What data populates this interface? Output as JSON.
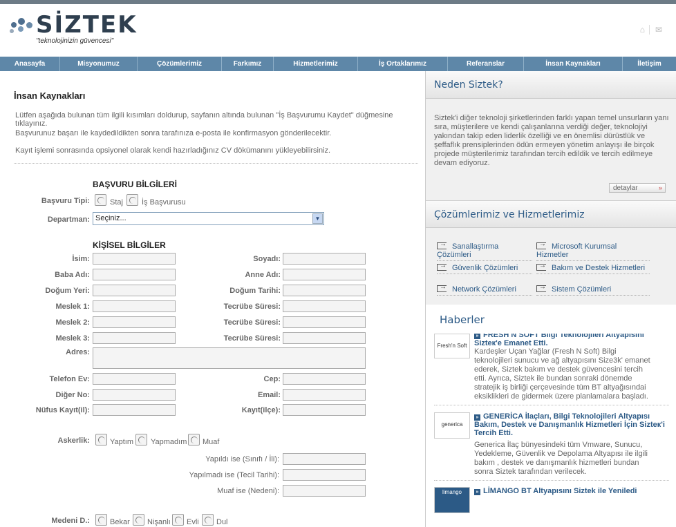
{
  "brand": {
    "logo_name": "SİZTEK",
    "tagline": "\"teknolojinizin güvencesi\""
  },
  "nav": [
    "Anasayfa",
    "Misyonumuz",
    "Çözümlerimiz",
    "Farkımız",
    "Hizmetlerimiz",
    "İş Ortaklarımız",
    "Referanslar",
    "İnsan Kaynakları",
    "İletişim"
  ],
  "page": {
    "title": "İnsan Kaynakları",
    "intro": [
      "Lütfen aşağıda bulunan tüm ilgili kısımları doldurup, sayfanın altında bulunan \"İş Başvurumu Kaydet\" düğmesine tıklayınız.",
      "Başvurunuz başarı ile kaydedildikten sonra tarafınıza e-posta ile konfirmasyon gönderilecektir.",
      "Kayıt işlemi sonrasında opsiyonel olarak kendi hazırladığınız CV dökümanını yükleyebilirsiniz."
    ]
  },
  "form": {
    "basvuru_title": "BAŞVURU BİLGİLERİ",
    "basvuru_tipi": "Başvuru Tipi:",
    "tip_opts": [
      "Staj",
      "İş Başvurusu"
    ],
    "departman": "Departman:",
    "departman_value": "Seçiniz...",
    "kisisel_title": "KİŞİSEL BİLGİLER",
    "left_labels": [
      "İsim:",
      "Baba Adı:",
      "Doğum Yeri:",
      "Meslek 1:",
      "Meslek 2:",
      "Meslek 3:"
    ],
    "right_labels": [
      "Soyadı:",
      "Anne Adı:",
      "Doğum Tarihi:",
      "Tecrübe Süresi:",
      "Tecrübe Süresi:",
      "Tecrübe Süresi:"
    ],
    "adres": "Adres:",
    "tel_labels": [
      "Telefon Ev:",
      "Diğer No:",
      "Nüfus Kayıt(il):"
    ],
    "tel_right": [
      "Cep:",
      "Email:",
      "Kayıt(ilçe):"
    ],
    "askerlik": "Askerlik:",
    "askerlik_opts": [
      "Yaptım",
      "Yapmadım",
      "Muaf"
    ],
    "asker_detail": [
      "Yapıldı ise (Sınıfı / İli):",
      "Yapılmadı ise (Tecil Tarihi):",
      "Muaf ise (Nedeni):"
    ],
    "medeni": "Medeni D.:",
    "medeni_opts": [
      "Bekar",
      "Nişanlı",
      "Evli",
      "Dul"
    ]
  },
  "sidebar": {
    "why_title": "Neden Siztek?",
    "why_text": "Siztek'i diğer teknoloji şirketlerinden farklı yapan temel unsurların yanı sıra, müşterilere ve kendi çalışanlarına verdiği değer, teknolojiyi yakından takip eden liderlik özelliği ve en önemlisi dürüstlük ve şeffaflık prensiplerinden ödün ermeyen yönetim anlayışı ile birçok projede müşterilerimiz tarafından tercih edildik ve tercih edilmeye devam ediyoruz.",
    "detay": "detaylar",
    "sol_title": "Çözümlerimiz ve Hizmetlerimiz",
    "solutions": [
      "Sanallaştırma Çözümleri",
      "Microsoft Kurumsal Hizmetler",
      "Güvenlik Çözümleri",
      "Bakım ve Destek Hizmetleri",
      "Network Çözümleri",
      "Sistem Çözümleri"
    ],
    "news_title": "Haberler",
    "news": [
      {
        "logo": "Fresh'n Soft",
        "title": "FRESH N SOFT Bilgi Teknolojileri Altyapısını Sizteк'e Emanet Etti.",
        "body": "Kardeşler Uçan Yağlar (Fresh N Soft) Bilgi teknolojileri sunucu ve ağ altyapısını Size3k' emanet ederek, Siztek bakım ve destek güvencesini tercih etti. Ayrıca, Siztek ile bundan sonraki dönemde stratejik iş birliği çerçevesinde tüm BT altyağısındai eksiklikleri de gidermek üzere planlamalara başladı."
      },
      {
        "logo": "generica",
        "title": "GENERİCA İlaçları, Bilgi Teknolojileri Altyapısı Bakım, Destek ve Danışmanlık Hizmetleri İçin Sizteк'i Tercih Etti.",
        "body": "Generica İlaç bünyesindeki tüm Vmware, Sunucu, Yedekleme, Güvenlik ve Depolama Altyapısı ile ilgili bakım , destek ve danışmanlık hizmetleri bundan sonra Siztek tarafından verilecek."
      },
      {
        "logo": "limango",
        "title": "LİMANGO BT Altyapısını Siztek ile Yeniledi",
        "body": ""
      }
    ]
  }
}
